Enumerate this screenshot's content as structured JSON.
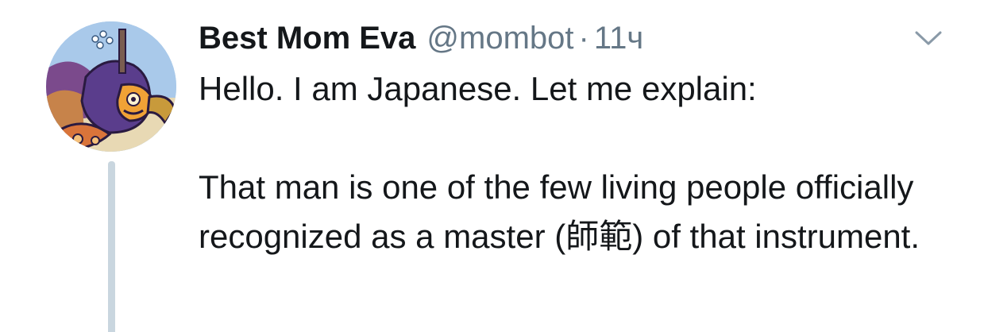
{
  "tweet": {
    "display_name": "Best Mom Eva",
    "handle": "@mombot",
    "separator": "·",
    "time": "11ч",
    "paragraphs": [
      "Hello. I am Japanese. Let me explain:",
      "That man is one of the few living people officially recognized as a master (師範) of that instrument."
    ]
  },
  "icons": {
    "menu": "chevron-down-icon",
    "avatar": "robot-cartoon-avatar"
  },
  "colors": {
    "text": "#14171a",
    "secondary": "#657786",
    "thread_line": "#c9d6df"
  }
}
